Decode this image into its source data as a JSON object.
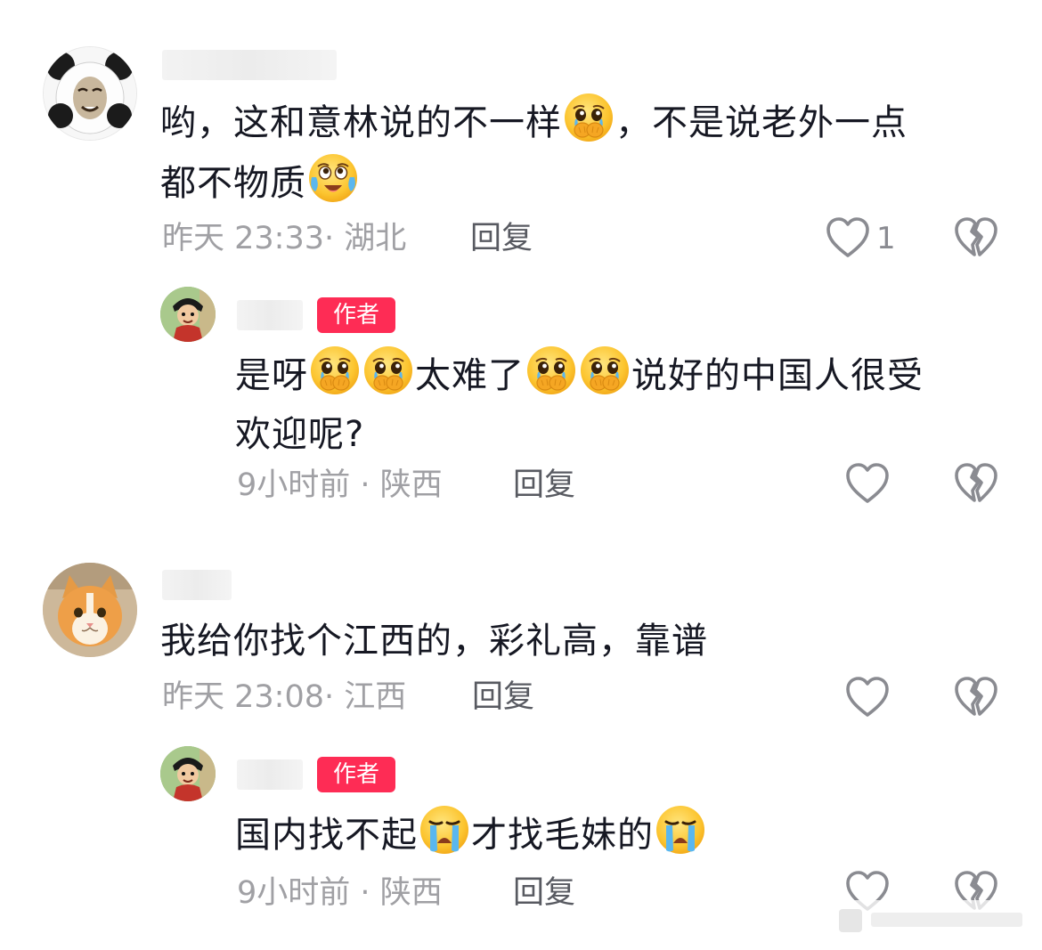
{
  "comments": [
    {
      "text_line1": "哟，这和意林说的不一样",
      "text_line1b": "，不是说老外一点",
      "text_line2": "都不物质",
      "time": "昨天 23:33",
      "location": "湖北",
      "reply_label": "回复",
      "like_count": "1",
      "reply": {
        "badge": "作者",
        "seg1": "是呀",
        "seg2": "太难了",
        "seg3": "说好的中国人很受",
        "line2": "欢迎呢?",
        "time": "9小时前",
        "location": "陕西",
        "reply_label": "回复"
      }
    },
    {
      "text": "我给你找个江西的，彩礼高，靠谱",
      "time": "昨天 23:08",
      "location": "江西",
      "reply_label": "回复",
      "reply": {
        "badge": "作者",
        "seg1": "国内找不起",
        "seg2": "才找毛妹的",
        "time": "9小时前",
        "location": "陕西",
        "reply_label": "回复"
      }
    }
  ],
  "meta_separator": "·",
  "icons": {
    "like": "heart-outline-icon",
    "dislike": "broken-heart-icon",
    "emoji_cover_mouth": "teary-cover-mouth-emoji",
    "emoji_laugh_cry": "laugh-cry-emoji",
    "emoji_cry": "loudly-crying-emoji"
  },
  "colors": {
    "badge": "#fe2c55",
    "text": "#161823",
    "meta": "#a0a0a4",
    "reply": "#585a61"
  }
}
